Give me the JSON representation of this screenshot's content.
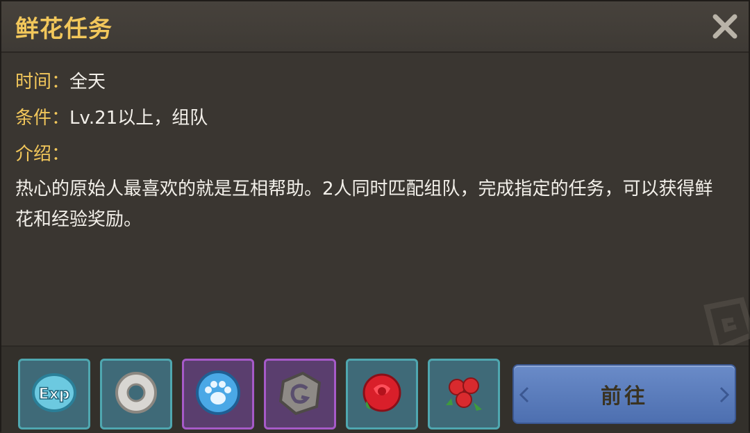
{
  "dialog": {
    "title": "鲜花任务",
    "close_label": "×"
  },
  "info": {
    "time_label": "时间：",
    "time_value": "全天",
    "condition_label": "条件：",
    "condition_value": "Lv.21以上，组队",
    "intro_label": "介绍：",
    "intro_text": "热心的原始人最喜欢的就是互相帮助。2人同时匹配组队，完成指定的任务，可以获得鲜花和经验奖励。"
  },
  "rewards": [
    {
      "icon": "exp-icon",
      "frame": "teal"
    },
    {
      "icon": "stone-ring-icon",
      "frame": "teal"
    },
    {
      "icon": "paw-stone-icon",
      "frame": "purple"
    },
    {
      "icon": "g-stone-icon",
      "frame": "purple"
    },
    {
      "icon": "rose-icon",
      "frame": "teal"
    },
    {
      "icon": "rose-bouquet-icon",
      "frame": "teal"
    }
  ],
  "go_button": {
    "label": "前往"
  },
  "colors": {
    "accent_gold": "#f2c75b",
    "button_blue": "#5b7cbc",
    "panel_dark": "#3a3631"
  }
}
